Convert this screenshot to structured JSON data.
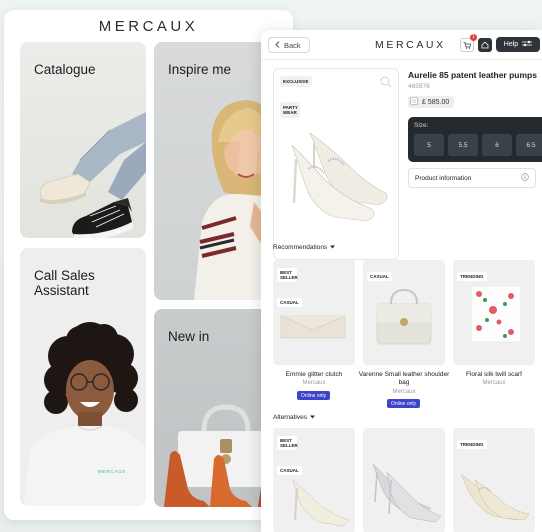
{
  "home": {
    "logo": "MERCAUX",
    "tiles": [
      {
        "label": "Catalogue"
      },
      {
        "label": "Inspire me"
      },
      {
        "label": "Call Sales Assistant"
      },
      {
        "label": "New in"
      }
    ],
    "shirt_brand": "MERCAUX"
  },
  "product": {
    "back_label": "Back",
    "logo": "MERCAUX",
    "cart_count": "1",
    "help_label": "Help",
    "image_tags": [
      "EXCLUSIVE",
      "PARTY WEAR"
    ],
    "title": "Aurelie 85 patent leather pumps",
    "sku": "465976",
    "price": "£ 585.00",
    "size_label": "Size:",
    "sizes": [
      "5",
      "5.5",
      "6",
      "6.5"
    ],
    "info_label": "Product information",
    "recommendations_label": "Recommendations",
    "recommendations": [
      {
        "tags": [
          "BEST SELLER",
          "CASUAL"
        ],
        "name": "Emmie glitter clutch",
        "brand": "Mercaux",
        "badge": "Online only"
      },
      {
        "tags": [
          "CASUAL"
        ],
        "name": "Varenne Small leather shoulder bag",
        "brand": "Mercaux",
        "badge": "Online only"
      },
      {
        "tags": [
          "TRENDING"
        ],
        "name": "Floral silk twill scarf",
        "brand": "Mercaux",
        "badge": ""
      }
    ],
    "alternatives_label": "Alternatives",
    "alternatives": [
      {
        "tags": [
          "BEST SELLER",
          "CASUAL"
        ]
      },
      {
        "tags": []
      },
      {
        "tags": [
          "TRENDING"
        ]
      }
    ]
  }
}
